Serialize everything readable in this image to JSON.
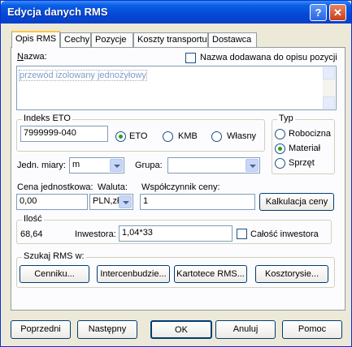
{
  "window": {
    "title": "Edycja danych RMS",
    "help_icon": "?",
    "close_icon": "✕"
  },
  "tabs": [
    "Opis RMS",
    "Cechy",
    "Pozycje",
    "Koszty transportu",
    "Dostawca"
  ],
  "name": {
    "label": "Nazwa:",
    "value": "przewód izolowany jednożyłowy",
    "checkbox_label": "Nazwa dodawana do opisu pozycji",
    "checkbox_checked": false
  },
  "eto": {
    "group_title": "Indeks ETO",
    "value": "7999999-040",
    "radio_eto": "ETO",
    "radio_kmb": "KMB",
    "radio_wlasny": "Własny",
    "selected": "ETO"
  },
  "typ": {
    "group_title": "Typ",
    "options": [
      "Robocizna",
      "Materiał",
      "Sprzęt"
    ],
    "selected": "Materiał"
  },
  "units": {
    "jedn_label": "Jedn. miary:",
    "jedn_value": "m",
    "grupa_label": "Grupa:",
    "grupa_value": ""
  },
  "price": {
    "cena_label": "Cena jednostkowa:",
    "cena_value": "0,00",
    "waluta_label": "Waluta:",
    "waluta_value": "PLN,zł",
    "wsp_label": "Współczynnik ceny:",
    "wsp_value": "1",
    "kalk_button": "Kalkulacja ceny"
  },
  "ilosc": {
    "group_title": "Ilość",
    "value": "68,64",
    "inwestora_label": "Inwestora:",
    "inwestora_value": "1,04*33",
    "calosc_label": "Całość inwestora",
    "calosc_checked": false
  },
  "search": {
    "group_title": "Szukaj RMS w:",
    "buttons": [
      "Cenniku...",
      "Intercenbudzie...",
      "Kartotece RMS...",
      "Kosztorysie..."
    ]
  },
  "footer": {
    "poprzedni": "Poprzedni",
    "nastepny": "Następny",
    "ok": "OK",
    "anuluj": "Anuluj",
    "pomoc": "Pomoc"
  }
}
